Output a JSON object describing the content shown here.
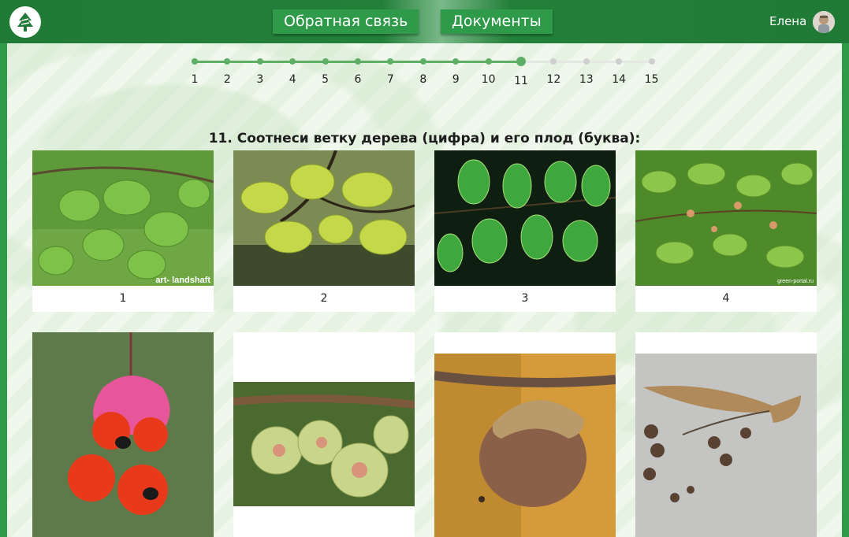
{
  "header": {
    "nav": [
      "Обратная связь",
      "Документы"
    ],
    "user_name": "Елена",
    "icons": {
      "logo": "tree-logo-icon",
      "avatar": "user-avatar"
    }
  },
  "stepper": {
    "steps": [
      "1",
      "2",
      "3",
      "4",
      "5",
      "6",
      "7",
      "8",
      "9",
      "10",
      "11",
      "12",
      "13",
      "14",
      "15"
    ],
    "current": 11,
    "progress_fraction": 0.714,
    "colors": {
      "done": "#5fae66",
      "todo": "#cfcfcf"
    }
  },
  "question": {
    "title": "11. Соотнеси ветку дерева (цифра) и его плод (буква):"
  },
  "branches": [
    {
      "label": "1",
      "watermark": "art- landshaft"
    },
    {
      "label": "2"
    },
    {
      "label": "3"
    },
    {
      "label": "4",
      "watermark": "green-portal.ru"
    }
  ],
  "fruits": [
    {
      "name": "euonymus-fruit"
    },
    {
      "name": "elm-samara-fruit"
    },
    {
      "name": "acorn-fruit"
    },
    {
      "name": "linden-fruit"
    }
  ],
  "colors": {
    "brand": "#2e9a4a",
    "header_dark": "#1f7a36",
    "frame": "#2f9a48"
  }
}
